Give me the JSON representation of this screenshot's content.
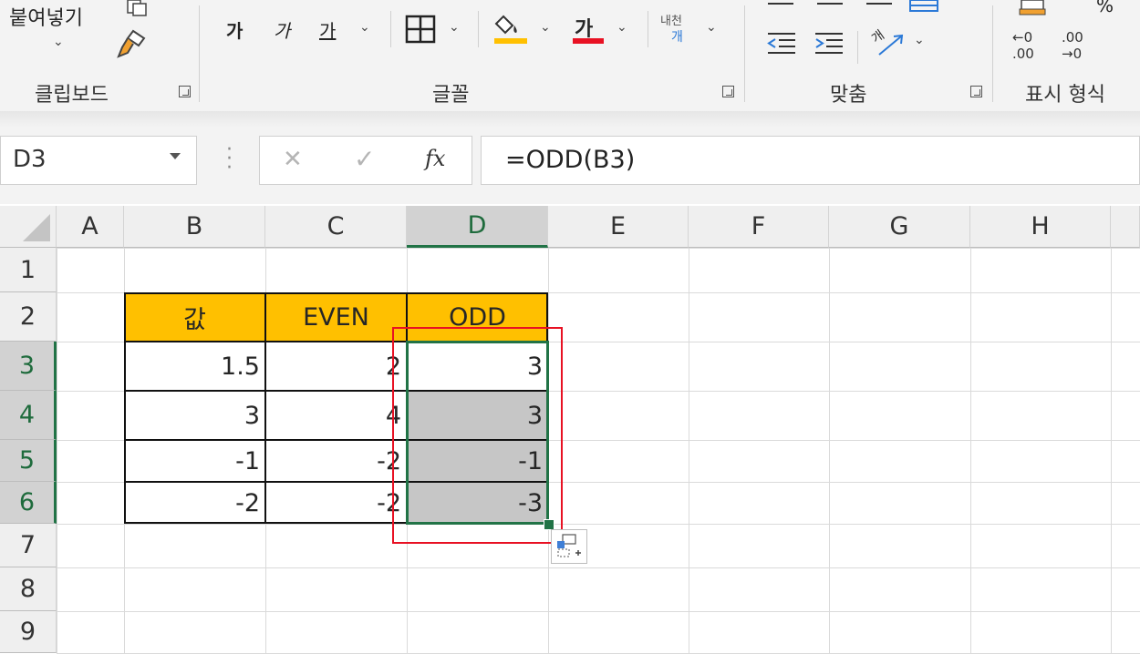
{
  "ribbon": {
    "clipboard": {
      "paste_label": "붙여넣기",
      "group_label": "클립보드"
    },
    "font": {
      "bold_glyph": "가",
      "italic_glyph": "가",
      "underline_glyph": "가",
      "phonetic_top": "내천",
      "phonetic_bottom": "개",
      "group_label": "글꼴",
      "fill_color": "#ffc000",
      "font_color": "#e81123"
    },
    "alignment": {
      "orientation_glyph": "개",
      "group_label": "맞춤"
    },
    "number": {
      "percent_glyph": "%",
      "inc_label": "←0 .00",
      "dec_label": ".00 →0",
      "group_label": "표시 형식"
    }
  },
  "formula_bar": {
    "name_box": "D3",
    "cancel_icon": "✕",
    "enter_icon": "✓",
    "fx_label": "fx",
    "formula": "=ODD(B3)"
  },
  "sheet": {
    "columns": [
      "A",
      "B",
      "C",
      "D",
      "E",
      "F",
      "G",
      "H"
    ],
    "rows": [
      "1",
      "2",
      "3",
      "4",
      "5",
      "6",
      "7",
      "8",
      "9"
    ],
    "selected_column": "D",
    "selected_rows": [
      "3",
      "4",
      "5",
      "6"
    ],
    "active_cell": "D3",
    "header_row": {
      "B": "값",
      "C": "EVEN",
      "D": "ODD"
    },
    "data_rows": [
      {
        "row": "3",
        "B": "1.5",
        "C": "2",
        "D": "3"
      },
      {
        "row": "4",
        "B": "3",
        "C": "4",
        "D": "3"
      },
      {
        "row": "5",
        "B": "-1",
        "C": "-2",
        "D": "-1"
      },
      {
        "row": "6",
        "B": "-2",
        "C": "-2",
        "D": "-3"
      }
    ],
    "header_fill": "#ffc000",
    "selection_fill": "#c6c6c6",
    "selection_border": "#217346",
    "annotation_border": "#e81123"
  }
}
